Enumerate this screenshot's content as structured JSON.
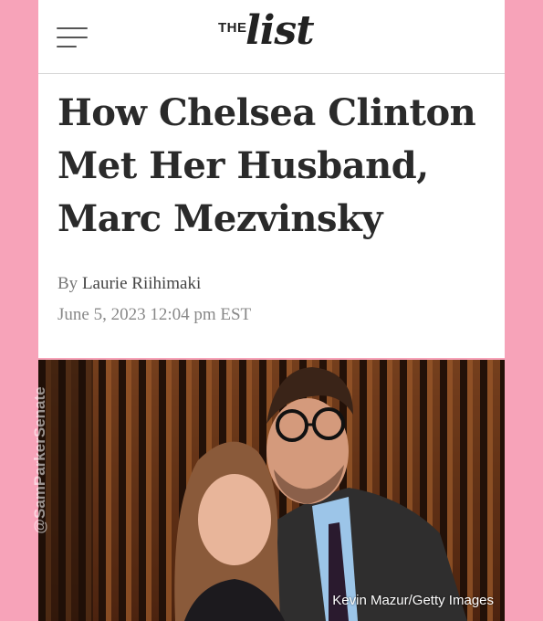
{
  "header": {
    "logo_small": "THE",
    "logo_main": "list"
  },
  "article": {
    "title": "How Chelsea Clinton Met Her Husband, Marc Mezvinsky",
    "by_prefix": "By",
    "author": "Laurie Riihimaki",
    "date": "June 5, 2023 12:04 pm EST"
  },
  "photo": {
    "watermark": "@SamParkerSenate",
    "credit": "Kevin Mazur/Getty Images"
  },
  "colors": {
    "page_border": "#f7a3b9",
    "headline": "#2a2a2a",
    "meta": "#777777"
  },
  "icons": {
    "menu": "hamburger-icon"
  }
}
